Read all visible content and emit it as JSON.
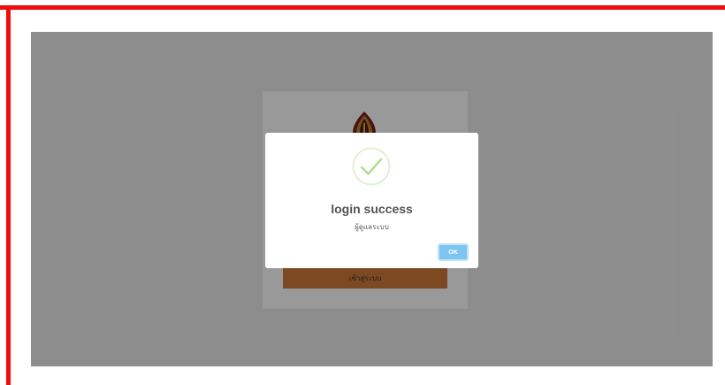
{
  "login_page": {
    "submit_label": "เข้าสู่ระบบ"
  },
  "dialog": {
    "title": "login success",
    "message": "ผู้ดูแลระบบ",
    "ok_label": "OK",
    "icon": "check-circle-icon"
  },
  "colors": {
    "frame": "#f20d0d",
    "success": "#a5dc86",
    "ok_button": "#7cc5f0",
    "submit_button": "#d07b39"
  }
}
